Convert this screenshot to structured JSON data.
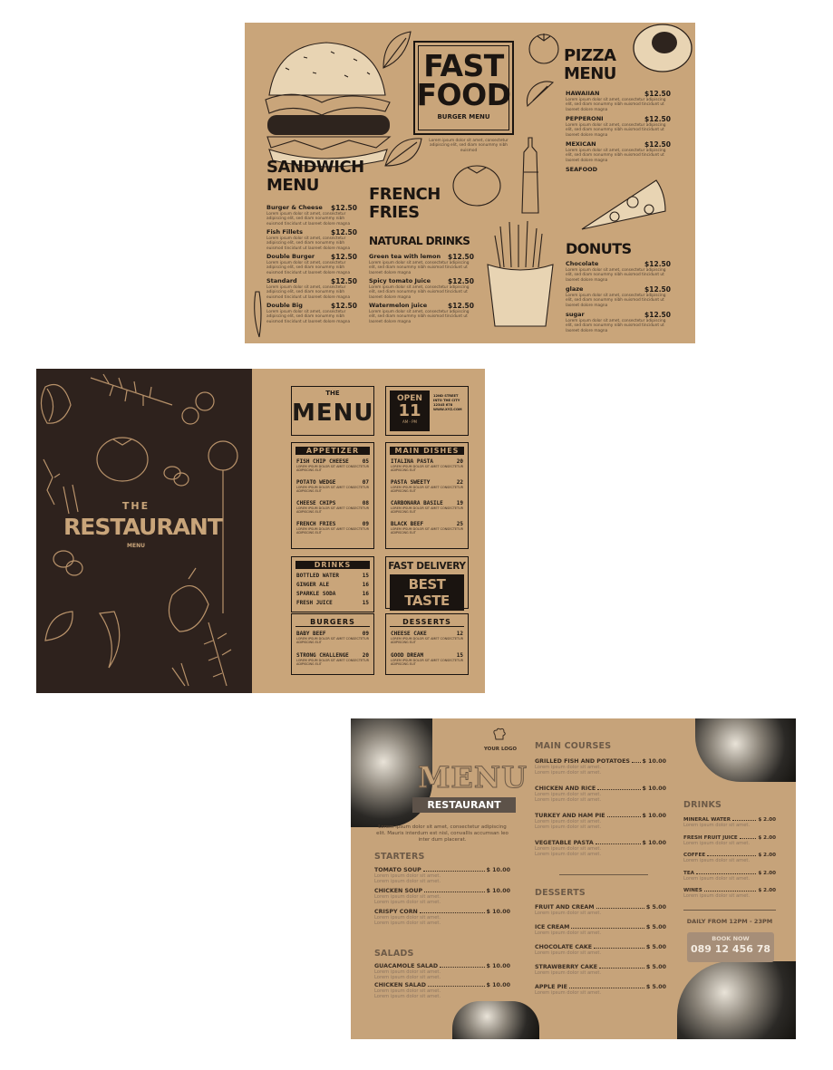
{
  "menu1": {
    "logo": {
      "line1": "FAST",
      "line2": "FOOD",
      "sub": "BURGER MENU"
    },
    "logo_lorem": "Lorem ipsum dolor sit amet, consectetur adipiscing elit, sed diam nonummy nibh euismod",
    "sandwich": {
      "title_line1": "SANDWICH",
      "title_line2": "MENU",
      "items": [
        {
          "name": "Burger & Cheese",
          "price": "$12.50"
        },
        {
          "name": "Fish Fillets",
          "price": "$12.50"
        },
        {
          "name": "Double Burger",
          "price": "$12.50"
        },
        {
          "name": "Standard",
          "price": "$12.50"
        },
        {
          "name": "Double Big",
          "price": "$12.50"
        }
      ]
    },
    "fries": {
      "line1": "FRENCH",
      "line2": "FRIES"
    },
    "drinks": {
      "title": "NATURAL DRINKS",
      "items": [
        {
          "name": "Green tea with lemon",
          "price": "$12.50"
        },
        {
          "name": "Spicy tomato Juice",
          "price": "$12.50"
        },
        {
          "name": "Watermelon juice",
          "price": "$12.50"
        }
      ]
    },
    "pizza": {
      "title_line1": "PIZZA",
      "title_line2": "MENU",
      "items": [
        {
          "name": "HAWAIIAN",
          "price": "$12.50"
        },
        {
          "name": "PEPPERONI",
          "price": "$12.50"
        },
        {
          "name": "MEXICAN",
          "price": "$12.50"
        },
        {
          "name": "SEAFOOD",
          "price": ""
        }
      ]
    },
    "donuts": {
      "title": "DONUTS",
      "items": [
        {
          "name": "Chocolate",
          "price": "$12.50"
        },
        {
          "name": "glaze",
          "price": "$12.50"
        },
        {
          "name": "sugar",
          "price": "$12.50"
        }
      ]
    },
    "lorem": "Lorem ipsum dolor sit amet, consectetur adipiscing elit, sed diam nonummy nibh euismod tincidunt ut laoreet dolore magna"
  },
  "menu2": {
    "cover": {
      "the": "THE",
      "title": "RESTAURANT",
      "sub": "MENU"
    },
    "header": {
      "the": "THE",
      "title": "MENU"
    },
    "open": {
      "label": "OPEN",
      "num": "11",
      "suffix": "AM - PM",
      "address": "12ND STREET INTO THE CITY 12345 678 WWW.XYZ.COM"
    },
    "appetizer": {
      "title": "APPETIZER",
      "items": [
        {
          "name": "FISH CHIP CHEESE",
          "price": "05"
        },
        {
          "name": "POTATO WEDGE",
          "price": "07"
        },
        {
          "name": "CHEESE CHIPS",
          "price": "08"
        },
        {
          "name": "FRENCH FRIES",
          "price": "09"
        }
      ]
    },
    "main": {
      "title": "MAIN DISHES",
      "items": [
        {
          "name": "ITALINA PASTA",
          "price": "20"
        },
        {
          "name": "PASTA SWEETY",
          "price": "22"
        },
        {
          "name": "CARBONARA BASILE",
          "price": "19"
        },
        {
          "name": "BLACK BEEF",
          "price": "25"
        }
      ]
    },
    "drinks": {
      "title": "DRINKS",
      "items": [
        {
          "name": "BOTTLED WATER",
          "price": "15"
        },
        {
          "name": "GINGER ALE",
          "price": "16"
        },
        {
          "name": "SPARKLE SODA",
          "price": "16"
        },
        {
          "name": "FRESH JUICE",
          "price": "15"
        }
      ]
    },
    "promo": {
      "line1": "FAST DELIVERY",
      "line2": "BEST TASTE"
    },
    "burgers": {
      "title": "BURGERS",
      "items": [
        {
          "name": "BABY BEEF",
          "price": "09"
        },
        {
          "name": "STRONG CHALLENGE",
          "price": "20"
        }
      ]
    },
    "desserts": {
      "title": "DESSERTS",
      "items": [
        {
          "name": "CHEESE CAKE",
          "price": "12"
        },
        {
          "name": "GOOD DREAM",
          "price": "15"
        }
      ]
    },
    "lorem": "LOREM IPSUM DOLOR SIT AMET CONSECTETUR ADIPISCING ELIT"
  },
  "menu3": {
    "logo": "YOUR LOGO",
    "title": "MENU",
    "subtitle": "RESTAURANT",
    "intro": "Lorem ipsum dolor sit amet, consectetur adipiscing elit. Mauris interdum est nisl, convallis accumsan leo inter dum placerat.",
    "starters": {
      "title": "STARTERS",
      "items": [
        {
          "name": "TOMATO SOUP",
          "price": "$ 10.00"
        },
        {
          "name": "CHICKEN SOUP",
          "price": "$ 10.00"
        },
        {
          "name": "CRISPY CORN",
          "price": "$ 10.00"
        }
      ]
    },
    "salads": {
      "title": "SALADS",
      "items": [
        {
          "name": "GUACAMOLE SALAD",
          "price": "$ 10.00"
        },
        {
          "name": "CHICKEN SALAD",
          "price": "$ 10.00"
        }
      ]
    },
    "main": {
      "title": "MAIN COURSES",
      "items": [
        {
          "name": "GRILLED FISH AND POTATOES",
          "price": "$ 10.00"
        },
        {
          "name": "CHICKEN AND RICE",
          "price": "$ 10.00"
        },
        {
          "name": "TURKEY AND HAM PIE",
          "price": "$ 10.00"
        },
        {
          "name": "VEGETABLE PASTA",
          "price": "$ 10.00"
        }
      ]
    },
    "desserts": {
      "title": "DESSERTS",
      "items": [
        {
          "name": "FRUIT AND CREAM",
          "price": "$ 5.00"
        },
        {
          "name": "ICE CREAM",
          "price": "$ 5.00"
        },
        {
          "name": "CHOCOLATE CAKE",
          "price": "$ 5.00"
        },
        {
          "name": "STRAWBERRY CAKE",
          "price": "$ 5.00"
        },
        {
          "name": "APPLE PIE",
          "price": "$ 5.00"
        }
      ]
    },
    "drinks": {
      "title": "DRINKS",
      "items": [
        {
          "name": "MINERAL WATER",
          "price": "$ 2.00"
        },
        {
          "name": "FRESH FRUIT JUICE",
          "price": "$ 2.00"
        },
        {
          "name": "COFFEE",
          "price": "$ 2.00"
        },
        {
          "name": "TEA",
          "price": "$ 2.00"
        },
        {
          "name": "WINES",
          "price": "$ 2.00"
        }
      ]
    },
    "hours": "DAILY FROM 12PM - 23PM",
    "book": "BOOK NOW",
    "phone": "089 12 456 78",
    "item_lorem": "Lorem ipsum dolor sit amet."
  }
}
